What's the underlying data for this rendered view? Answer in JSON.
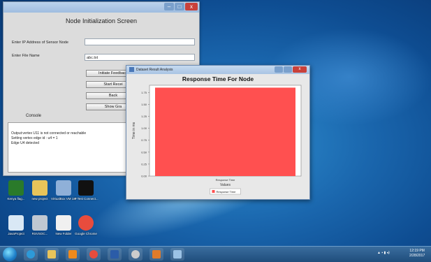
{
  "node_window": {
    "caption": {
      "minimize": "–",
      "maximize": "□",
      "close": "x"
    },
    "title": "Node Initialization Screen",
    "ip_label": "Enter IP Address of Sensor Node",
    "ip_value": "",
    "file_label": "Enter File Name",
    "file_value": "abc.txt",
    "buttons": [
      "Initiate Feedback",
      "Start Recei",
      "Back",
      "Show Gra"
    ],
    "console_label": "Console",
    "console_lines": [
      "Output:vertex U11 is not connected or reachable",
      "Setting vertex edge id : u4 = 1",
      "Edge U4 detected"
    ]
  },
  "dataset_window": {
    "title": "Dataset Result Analysis",
    "close": "x"
  },
  "chart_data": {
    "type": "bar",
    "title": "Response Time For Node",
    "xlabel": "Values",
    "ylabel": "Time in ms",
    "categories": [
      "Response Time"
    ],
    "series": [
      {
        "name": "Response Time",
        "values": [
          1.85
        ]
      }
    ],
    "ylim": [
      0,
      1.9
    ],
    "yticks": [
      "0.00",
      "0.25",
      "0.50",
      "0.75",
      "1.00",
      "1.25",
      "1.50",
      "1.75"
    ],
    "colors": {
      "bar": "#ff5050"
    },
    "legend": "bottom",
    "grid": false
  },
  "desktop_icons": [
    {
      "label": "Kenya flag...",
      "icon": "flag-icon",
      "color": "#2a7a2a"
    },
    {
      "label": "new project",
      "icon": "folder-icon",
      "color": "#e8c45a"
    },
    {
      "label": "VirtualBox VM 1.0",
      "icon": "virtualbox-icon",
      "color": "#8fb0d8"
    },
    {
      "label": "IP Test Connect...",
      "icon": "d-icon",
      "color": "#111111"
    },
    {
      "label": "JavaProject",
      "icon": "java-icon",
      "color": "#d9e8f5"
    },
    {
      "label": "RSVSOC...",
      "icon": "settings-icon",
      "color": "#c0c8d2"
    },
    {
      "label": "New Folder",
      "icon": "file-icon",
      "color": "#f0f0f0"
    },
    {
      "label": "Google Chrome",
      "icon": "chrome-icon",
      "color": "#e84c3d"
    }
  ],
  "taskbar": {
    "apps": [
      {
        "icon": "ie-icon",
        "color": "#2d9ad8"
      },
      {
        "icon": "folder-icon",
        "color": "#e8c45a"
      },
      {
        "icon": "media-player-icon",
        "color": "#f08a1c"
      },
      {
        "icon": "chrome-icon",
        "color": "#e84c3d"
      },
      {
        "icon": "word-icon",
        "color": "#2b5ca8"
      },
      {
        "icon": "circle-app-icon",
        "color": "#cccccc"
      },
      {
        "icon": "java-icon",
        "color": "#e07b2a"
      },
      {
        "icon": "paint-icon",
        "color": "#9bc2e6"
      }
    ],
    "time": "12:19 PM",
    "date": "2/28/2017"
  }
}
